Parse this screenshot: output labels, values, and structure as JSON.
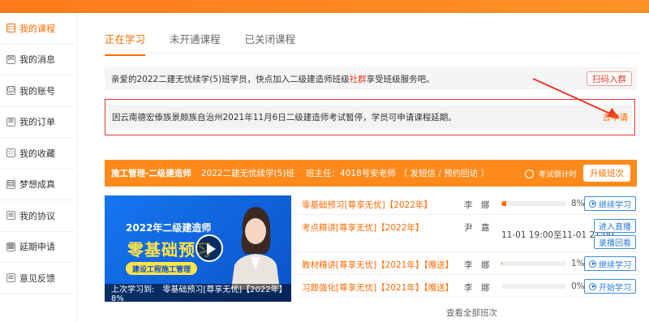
{
  "sidebar": {
    "items": [
      {
        "label": "我的课程",
        "icon": "monitor-icon",
        "glyph": "▭",
        "active": true
      },
      {
        "label": "我的消息",
        "icon": "mail-icon",
        "glyph": "✉",
        "active": false
      },
      {
        "label": "我的账号",
        "icon": "user-icon",
        "glyph": "☺",
        "active": false
      },
      {
        "label": "我的订单",
        "icon": "order-icon",
        "glyph": "≡",
        "active": false
      },
      {
        "label": "我的收藏",
        "icon": "star-icon",
        "glyph": "☆",
        "active": false
      },
      {
        "label": "梦想成真",
        "icon": "book-icon",
        "glyph": "▤",
        "active": false
      },
      {
        "label": "我的协议",
        "icon": "document-icon",
        "glyph": "≡",
        "active": false
      },
      {
        "label": "延期申请",
        "icon": "calendar-icon",
        "glyph": "▦",
        "active": false
      },
      {
        "label": "意见反馈",
        "icon": "feedback-icon",
        "glyph": "≡",
        "active": false
      }
    ]
  },
  "tabs": [
    "正在学习",
    "未开通课程",
    "已关闭课程"
  ],
  "notice1": {
    "text_before": "亲爱的2022二建无忧续学(5)班学员，快点加入二级建造师班级",
    "highlight": "社群",
    "text_after": "享受班级服务吧。",
    "button": "扫码入群"
  },
  "notice2": {
    "text": "因云南德宏傣族景颇族自治州2021年11月6日二级建造师考试暂停，学员可申请课程延期。",
    "link": "去申请"
  },
  "course": {
    "name": "施工管理-二级建造师",
    "class_name": "2022二建无忧续学(5)班",
    "teacher": "班主任：4018号安老师",
    "links": "（ 发短信 / 预约回访 ）",
    "countdown": "考试倒计时",
    "upgrade": "升级班次",
    "cover": {
      "year_title": "2022年二级建造师",
      "big_title": "零基础预习",
      "pill": "建设工程施工管理",
      "last_study": "上次学习到:　零基础预习[尊享无忧]【2022年】 8%"
    },
    "rows": [
      {
        "name": "零基础预习[尊享无忧]【2022年】",
        "teacher": "李　娜",
        "progress": 0.08,
        "pct": "8%",
        "action": "继续学习"
      },
      {
        "name": "考点精讲[尊享无忧]【2022年】",
        "teacher": "尹　嘉",
        "time": "11-01 19:00至11-01 21:00",
        "actions": [
          "进入直播",
          "录播回看"
        ]
      },
      {
        "name": "教材精讲[尊享无忧]【2021年】【赠送】",
        "teacher": "李　娜",
        "progress": 0.01,
        "pct": "1%",
        "action": "继续学习"
      },
      {
        "name": "习题强化[尊享无忧]【2021年】【赠送】",
        "teacher": "李　娜",
        "progress": 0.0,
        "pct": "0%",
        "action": "开始学习"
      }
    ],
    "view_all": "查看全部班次"
  },
  "colors": {
    "accent": "#ff6a00",
    "header": "#ff8a1c",
    "alert": "#e8372b",
    "blue": "#2a7bd6"
  }
}
